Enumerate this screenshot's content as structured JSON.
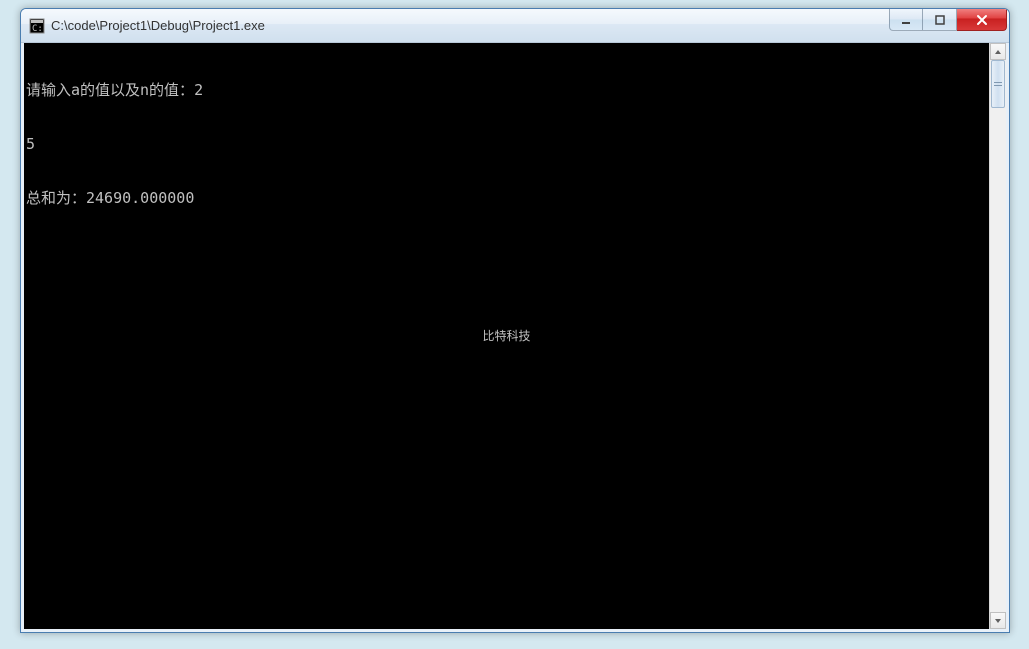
{
  "window": {
    "title": "C:\\code\\Project1\\Debug\\Project1.exe"
  },
  "console": {
    "line1": "请输入a的值以及n的值：2",
    "line2": "5",
    "line3": "总和为：24690.000000"
  },
  "watermark": "比特科技",
  "controls": {
    "minimize": "minimize",
    "maximize": "maximize",
    "close": "close"
  }
}
